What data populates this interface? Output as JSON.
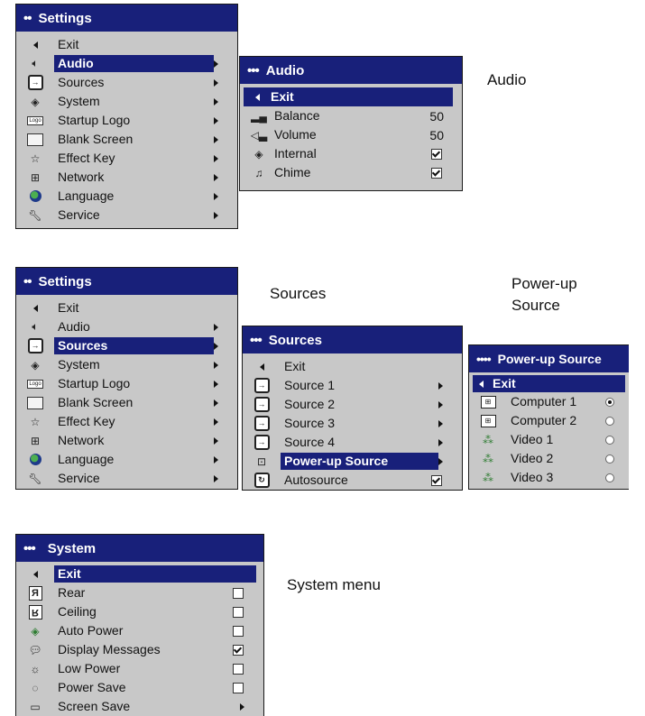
{
  "settings1": {
    "title": "Settings",
    "items": [
      {
        "label": "Exit"
      },
      {
        "label": "Audio"
      },
      {
        "label": "Sources"
      },
      {
        "label": "System"
      },
      {
        "label": "Startup Logo"
      },
      {
        "label": "Blank Screen"
      },
      {
        "label": "Effect Key"
      },
      {
        "label": "Network"
      },
      {
        "label": "Language"
      },
      {
        "label": "Service"
      }
    ]
  },
  "audio": {
    "title": "Audio",
    "caption": "Audio",
    "exit": "Exit",
    "items": [
      {
        "label": "Balance",
        "value": "50"
      },
      {
        "label": "Volume",
        "value": "50"
      },
      {
        "label": "Internal",
        "checked": true
      },
      {
        "label": "Chime",
        "checked": true
      }
    ]
  },
  "settings2": {
    "title": "Settings",
    "items": [
      {
        "label": "Exit"
      },
      {
        "label": "Audio"
      },
      {
        "label": "Sources"
      },
      {
        "label": "System"
      },
      {
        "label": "Startup Logo"
      },
      {
        "label": "Blank Screen"
      },
      {
        "label": "Effect Key"
      },
      {
        "label": "Network"
      },
      {
        "label": "Language"
      },
      {
        "label": "Service"
      }
    ]
  },
  "sources": {
    "title": "Sources",
    "caption": "Sources",
    "items": [
      {
        "label": "Exit"
      },
      {
        "label": "Source 1"
      },
      {
        "label": "Source 2"
      },
      {
        "label": "Source 3"
      },
      {
        "label": "Source 4"
      },
      {
        "label": "Power-up Source"
      },
      {
        "label": "Autosource",
        "checked": true
      }
    ]
  },
  "powerup": {
    "title": "Power-up Source",
    "caption_line1": "Power-up",
    "caption_line2": "Source",
    "exit": "Exit",
    "items": [
      {
        "label": "Computer 1",
        "selected": true
      },
      {
        "label": "Computer 2",
        "selected": false
      },
      {
        "label": "Video 1",
        "selected": false
      },
      {
        "label": "Video 2",
        "selected": false
      },
      {
        "label": "Video 3",
        "selected": false
      }
    ]
  },
  "system": {
    "title": "System",
    "caption": "System menu",
    "exit": "Exit",
    "items": [
      {
        "label": "Rear",
        "checked": false
      },
      {
        "label": "Ceiling",
        "checked": false
      },
      {
        "label": "Auto Power",
        "checked": false
      },
      {
        "label": "Display Messages",
        "checked": true
      },
      {
        "label": "Low Power",
        "checked": false
      },
      {
        "label": "Power Save",
        "checked": false
      },
      {
        "label": "Screen Save"
      }
    ]
  },
  "colors": {
    "title_bar": "#18207a",
    "menu_bg": "#c8c8c8",
    "highlight": "#18207a"
  }
}
